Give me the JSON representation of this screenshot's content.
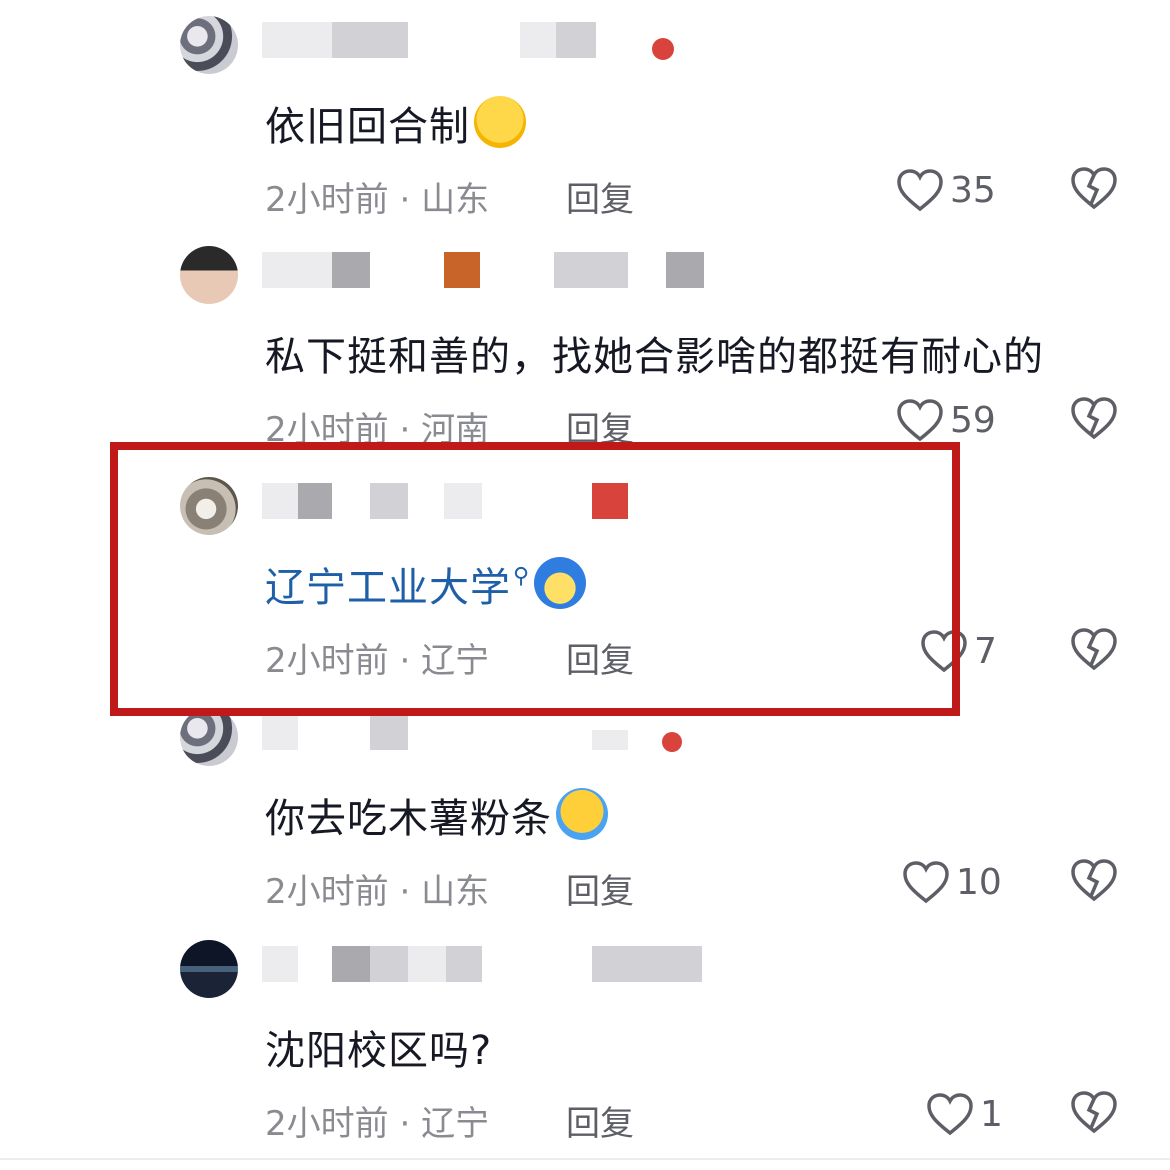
{
  "comments": [
    {
      "avatar": "avatar-abstract-grey",
      "text": "依旧回合制",
      "emoji": "tears-of-joy-emoji",
      "time": "2小时前",
      "location": "山东",
      "reply": "回复",
      "likes": "35"
    },
    {
      "avatar": "avatar-girl-hat",
      "text": "私下挺和善的，找她合影啥的都挺有耐心的",
      "time": "2小时前",
      "location": "河南",
      "reply": "回复",
      "likes": "59"
    },
    {
      "avatar": "avatar-cat",
      "text": "辽宁工业大学",
      "emoji": "smirk-blue-hair-emoji",
      "time": "2小时前",
      "location": "辽宁",
      "reply": "回复",
      "likes": "7"
    },
    {
      "avatar": "avatar-abstract-grey",
      "text": "你去吃木薯粉条",
      "emoji": "crying-emoji",
      "time": "2小时前",
      "location": "山东",
      "reply": "回复",
      "likes": "10"
    },
    {
      "avatar": "avatar-night-sky",
      "text": "沈阳校区吗?",
      "time": "2小时前",
      "location": "辽宁",
      "reply": "回复",
      "likes": "1"
    }
  ],
  "separator": "·",
  "colors": {
    "highlight": "#c0191a",
    "link": "#1e5fa8",
    "meta": "#8a8b91"
  }
}
